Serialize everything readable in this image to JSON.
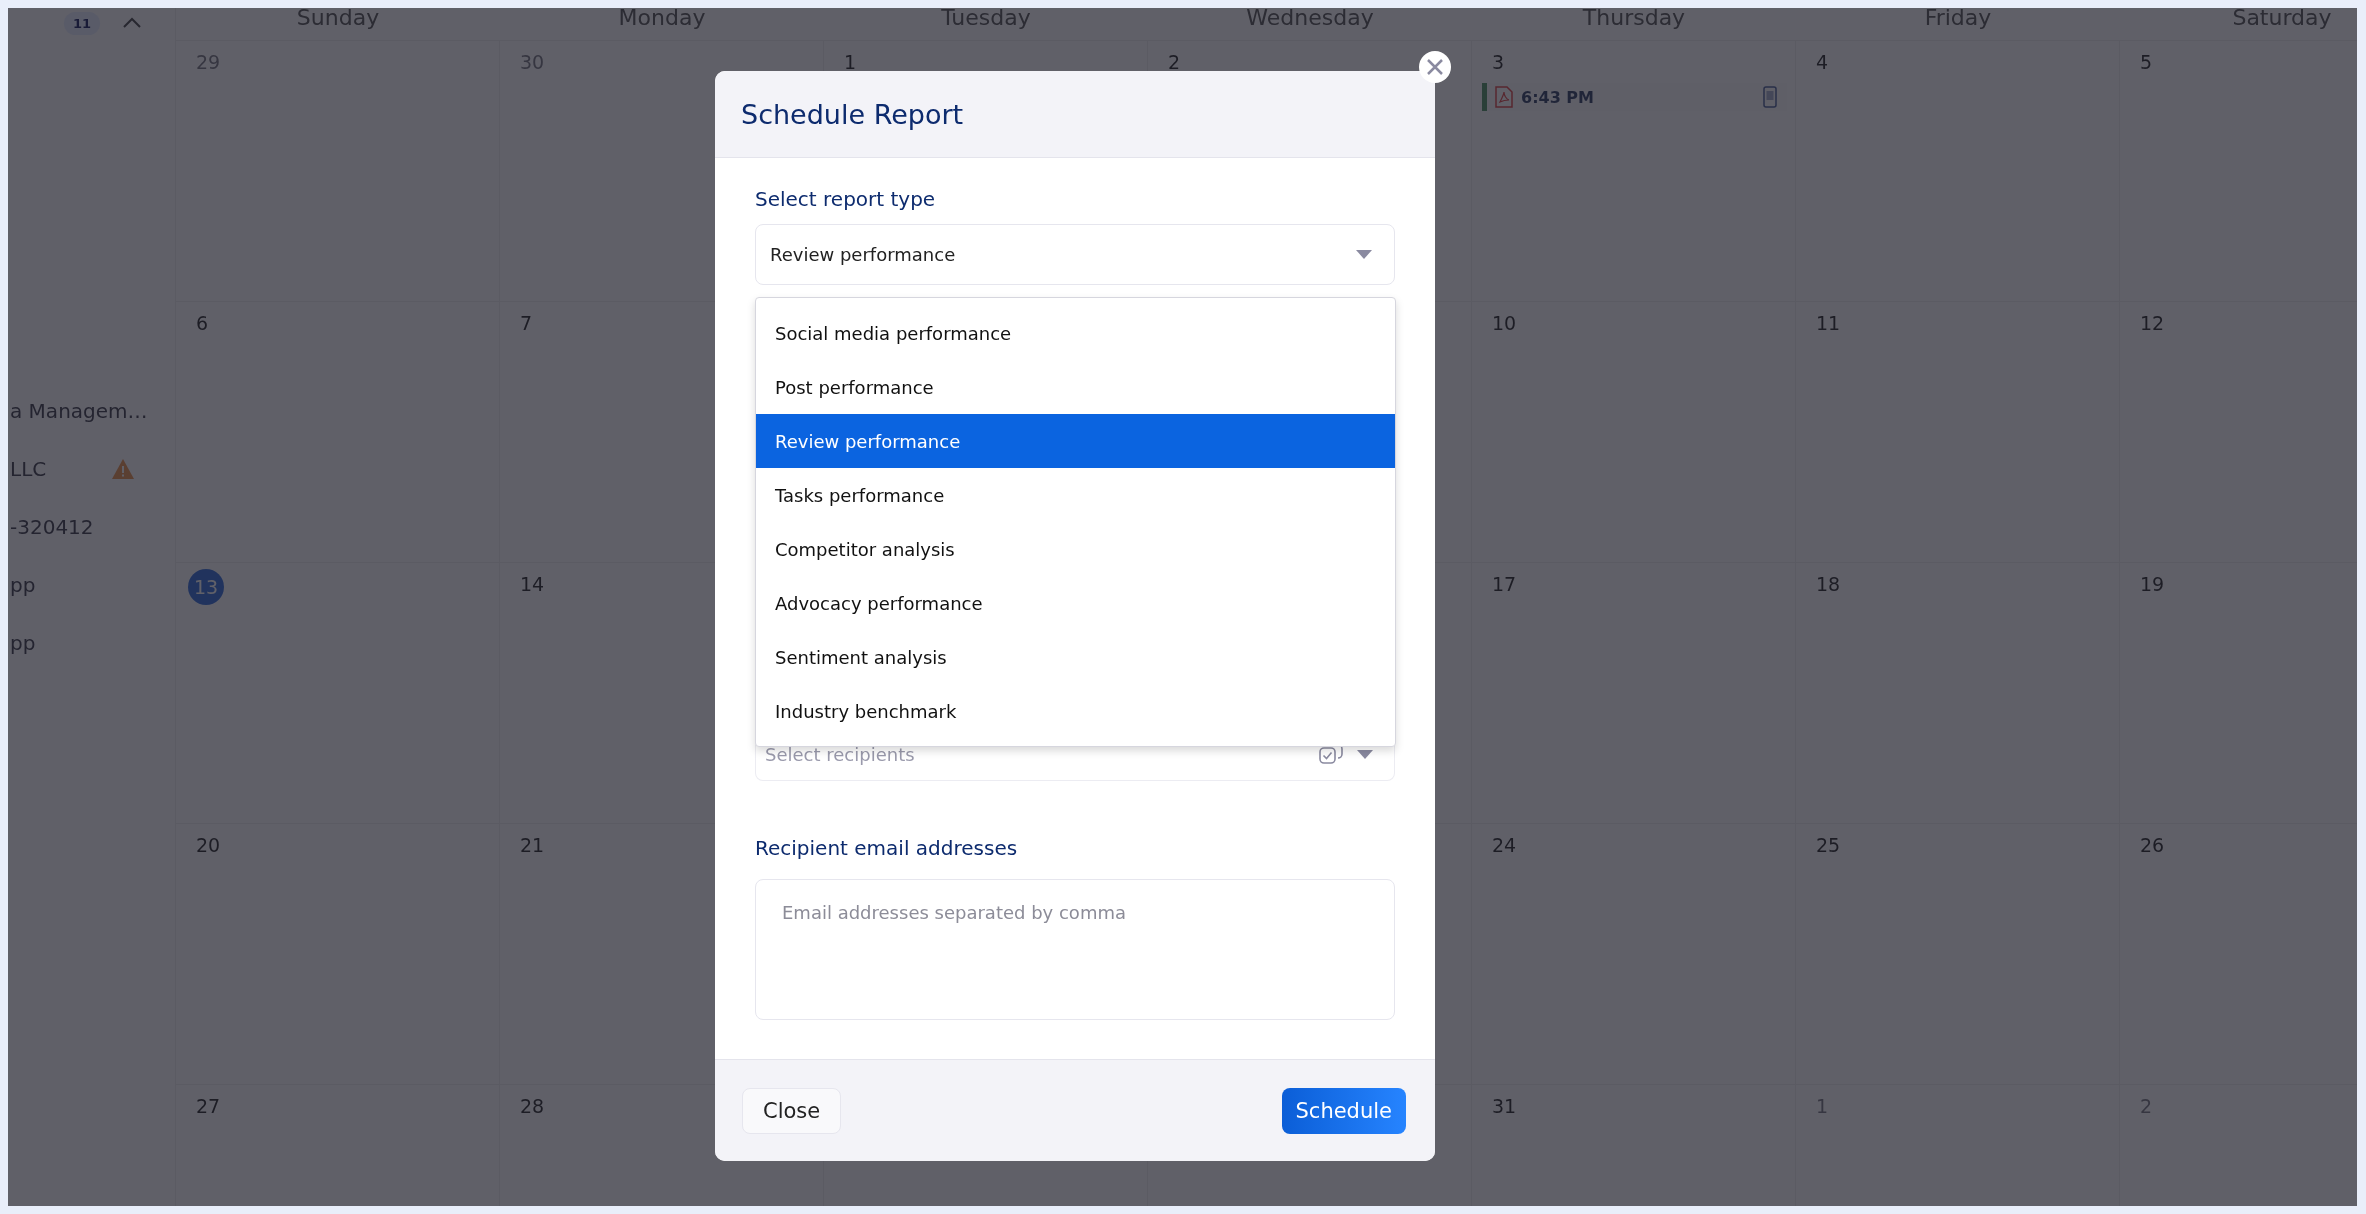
{
  "sidebar": {
    "badge": "11",
    "items": [
      {
        "label": "a Managem…",
        "warning": false
      },
      {
        "label": "LLC",
        "warning": true
      },
      {
        "label": "-320412",
        "warning": false
      },
      {
        "label": "pp",
        "warning": false
      },
      {
        "label": "pp",
        "warning": false
      }
    ]
  },
  "calendar": {
    "weekdays": [
      "Sunday",
      "Monday",
      "Tuesday",
      "Wednesday",
      "Thursday",
      "Friday",
      "Saturday"
    ],
    "weeks": [
      [
        {
          "day": "29",
          "kind": "outside"
        },
        {
          "day": "30",
          "kind": "outside"
        },
        {
          "day": "1",
          "kind": "current"
        },
        {
          "day": "2",
          "kind": "current"
        },
        {
          "day": "3",
          "kind": "current",
          "events": [
            {
              "time": "6:43 PM"
            }
          ]
        },
        {
          "day": "4",
          "kind": "current"
        },
        {
          "day": "5",
          "kind": "current"
        }
      ],
      [
        {
          "day": "6",
          "kind": "current"
        },
        {
          "day": "7",
          "kind": "current"
        },
        {
          "day": "10",
          "kind": "current"
        },
        {
          "day": "11",
          "kind": "current"
        },
        {
          "day": "12",
          "kind": "current"
        }
      ],
      [
        {
          "day": "13",
          "kind": "today"
        },
        {
          "day": "14",
          "kind": "current"
        },
        {
          "day": "17",
          "kind": "current"
        },
        {
          "day": "18",
          "kind": "current"
        },
        {
          "day": "19",
          "kind": "current"
        }
      ],
      [
        {
          "day": "20",
          "kind": "current"
        },
        {
          "day": "21",
          "kind": "current"
        },
        {
          "day": "24",
          "kind": "current"
        },
        {
          "day": "25",
          "kind": "current"
        },
        {
          "day": "26",
          "kind": "current"
        }
      ],
      [
        {
          "day": "27",
          "kind": "current"
        },
        {
          "day": "28",
          "kind": "current"
        },
        {
          "day": "31",
          "kind": "current"
        },
        {
          "day": "1",
          "kind": "outside"
        },
        {
          "day": "2",
          "kind": "outside"
        }
      ]
    ]
  },
  "modal": {
    "title": "Schedule Report",
    "report_type": {
      "label": "Select report type",
      "value": "Review performance",
      "expanded": true,
      "options": [
        {
          "label": "Social media performance",
          "selected": false
        },
        {
          "label": "Post performance",
          "selected": false
        },
        {
          "label": "Review performance",
          "selected": true
        },
        {
          "label": "Tasks performance",
          "selected": false
        },
        {
          "label": "Competitor analysis",
          "selected": false
        },
        {
          "label": "Advocacy performance",
          "selected": false
        },
        {
          "label": "Sentiment analysis",
          "selected": false
        },
        {
          "label": "Industry benchmark",
          "selected": false
        }
      ]
    },
    "recipients": {
      "placeholder": "Select recipients"
    },
    "emails": {
      "label": "Recipient email addresses",
      "placeholder": "Email addresses separated by comma"
    },
    "buttons": [
      {
        "label": "Close",
        "kind": "secondary"
      },
      {
        "label": "Schedule",
        "kind": "primary"
      }
    ]
  }
}
